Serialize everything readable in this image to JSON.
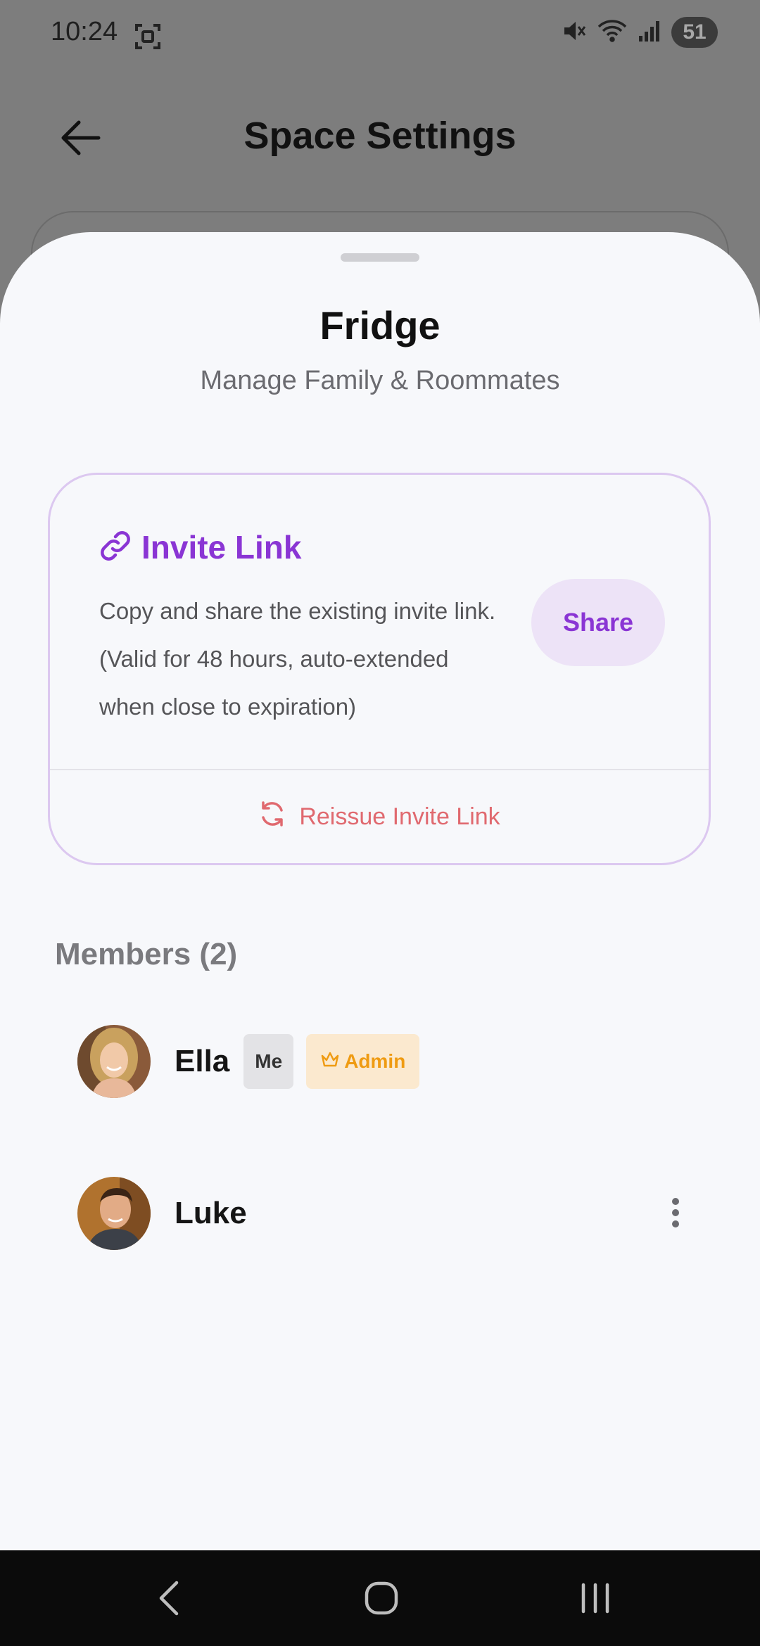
{
  "status_bar": {
    "time": "10:24",
    "battery": "51",
    "icons": [
      "screenshot-icon",
      "mute-icon",
      "wifi-icon",
      "signal-icon",
      "battery-icon"
    ]
  },
  "header": {
    "title": "Space Settings",
    "back_icon": "back-arrow-icon"
  },
  "sheet": {
    "title": "Fridge",
    "subtitle": "Manage Family & Roommates",
    "invite": {
      "title": "Invite Link",
      "description": "Copy and share the existing invite link. (Valid for 48 hours, auto-extended when close to expiration)",
      "share_label": "Share",
      "reissue_label": "Reissue Invite Link"
    },
    "members": {
      "heading": "Members (2)",
      "list": [
        {
          "name": "Ella",
          "badges": {
            "me": "Me",
            "admin": "Admin"
          }
        },
        {
          "name": "Luke"
        }
      ]
    }
  },
  "colors": {
    "accent": "#8a35d4",
    "accent_bg": "#ede3f7",
    "danger": "#e0696f",
    "admin": "#ef9b12",
    "admin_bg": "#fbe9cf",
    "sheet_bg": "#f7f8fb",
    "scrim": "#7d7d7d"
  }
}
